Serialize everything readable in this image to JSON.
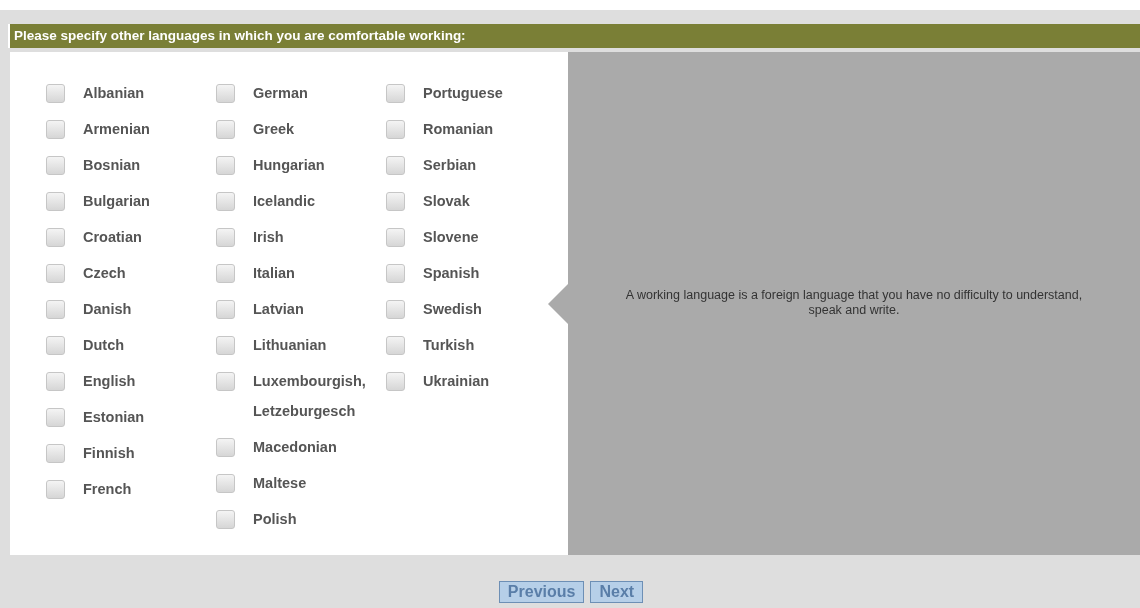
{
  "question": "Please specify other languages in which you are comfortable working:",
  "columns": [
    [
      {
        "label": "Albanian",
        "checked": false
      },
      {
        "label": "Armenian",
        "checked": false
      },
      {
        "label": "Bosnian",
        "checked": false
      },
      {
        "label": "Bulgarian",
        "checked": false
      },
      {
        "label": "Croatian",
        "checked": false
      },
      {
        "label": "Czech",
        "checked": false
      },
      {
        "label": "Danish",
        "checked": false
      },
      {
        "label": "Dutch",
        "checked": false
      },
      {
        "label": "English",
        "checked": false
      },
      {
        "label": "Estonian",
        "checked": false
      },
      {
        "label": "Finnish",
        "checked": false
      },
      {
        "label": "French",
        "checked": false
      }
    ],
    [
      {
        "label": "German",
        "checked": false
      },
      {
        "label": "Greek",
        "checked": false
      },
      {
        "label": "Hungarian",
        "checked": false
      },
      {
        "label": "Icelandic",
        "checked": false
      },
      {
        "label": "Irish",
        "checked": false
      },
      {
        "label": "Italian",
        "checked": false
      },
      {
        "label": "Latvian",
        "checked": false
      },
      {
        "label": "Lithuanian",
        "checked": false
      },
      {
        "label": "Luxembourgish, Letzeburgesch",
        "checked": false
      },
      {
        "label": "Macedonian",
        "checked": false
      },
      {
        "label": "Maltese",
        "checked": false
      },
      {
        "label": "Polish",
        "checked": false
      }
    ],
    [
      {
        "label": "Portuguese",
        "checked": false
      },
      {
        "label": "Romanian",
        "checked": false
      },
      {
        "label": "Serbian",
        "checked": false
      },
      {
        "label": "Slovak",
        "checked": false
      },
      {
        "label": "Slovene",
        "checked": false
      },
      {
        "label": "Spanish",
        "checked": false
      },
      {
        "label": "Swedish",
        "checked": false
      },
      {
        "label": "Turkish",
        "checked": false
      },
      {
        "label": "Ukrainian",
        "checked": false
      }
    ]
  ],
  "help_text": "A working language is a foreign language that you have no difficulty to understand, speak and write.",
  "buttons": [
    {
      "label": "Previous"
    },
    {
      "label": "Next"
    }
  ]
}
